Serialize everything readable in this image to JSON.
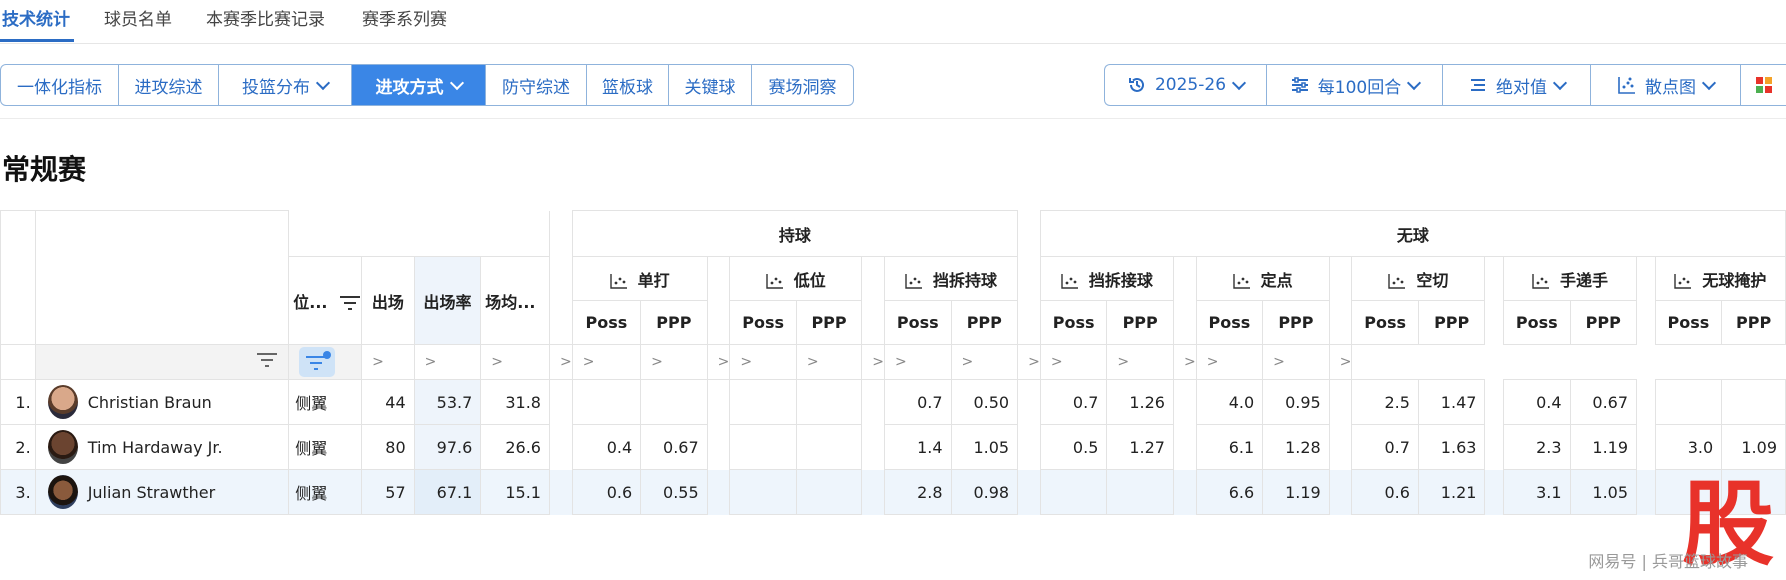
{
  "top_tabs": [
    "技术统计",
    "球员名单",
    "本赛季比赛记录",
    "赛季系列赛"
  ],
  "category_buttons": [
    "一体化指标",
    "进攻综述",
    "投篮分布",
    "进攻方式",
    "防守综述",
    "篮板球",
    "关键球",
    "赛场洞察"
  ],
  "active_category": "进攻方式",
  "controls": {
    "season": "2025-26",
    "per_mode": "每100回合",
    "value_mode": "绝对值",
    "chart_mode": "散点图"
  },
  "section_title": "常规赛",
  "table": {
    "basic_headers": {
      "position": "位...",
      "games": "出场",
      "games_pct": "出场率",
      "minutes": "场均..."
    },
    "groups": {
      "on_ball": "持球",
      "off_ball": "无球"
    },
    "play_types": [
      "单打",
      "低位",
      "挡拆持球",
      "挡拆接球",
      "定点",
      "空切",
      "手递手",
      "无球掩护"
    ],
    "sub_headers": {
      "poss": "Poss",
      "ppp": "PPP"
    },
    "filter_symbol": ">",
    "rows": [
      {
        "rank": "1.",
        "name": "Christian Braun",
        "pos": "侧翼",
        "gp": "44",
        "gp_pct": "53.7",
        "min": "31.8",
        "stats": [
          [
            "",
            ""
          ],
          [
            "",
            ""
          ],
          [
            "0.7",
            "0.50"
          ],
          [
            "0.7",
            "1.26"
          ],
          [
            "4.0",
            "0.95"
          ],
          [
            "2.5",
            "1.47"
          ],
          [
            "0.4",
            "0.67"
          ],
          [
            "",
            ""
          ]
        ]
      },
      {
        "rank": "2.",
        "name": "Tim Hardaway Jr.",
        "pos": "侧翼",
        "gp": "80",
        "gp_pct": "97.6",
        "min": "26.6",
        "stats": [
          [
            "0.4",
            "0.67"
          ],
          [
            "",
            ""
          ],
          [
            "1.4",
            "1.05"
          ],
          [
            "0.5",
            "1.27"
          ],
          [
            "6.1",
            "1.28"
          ],
          [
            "0.7",
            "1.63"
          ],
          [
            "2.3",
            "1.19"
          ],
          [
            "3.0",
            "1.09"
          ]
        ]
      },
      {
        "rank": "3.",
        "name": "Julian Strawther",
        "pos": "侧翼",
        "gp": "57",
        "gp_pct": "67.1",
        "min": "15.1",
        "stats": [
          [
            "0.6",
            "0.55"
          ],
          [
            "",
            ""
          ],
          [
            "2.8",
            "0.98"
          ],
          [
            "",
            ""
          ],
          [
            "6.6",
            "1.19"
          ],
          [
            "0.6",
            "1.21"
          ],
          [
            "3.1",
            "1.05"
          ],
          [
            "",
            ""
          ]
        ]
      }
    ]
  },
  "watermark": "网易号 | 兵哥篮球故事",
  "overlay_char": "股",
  "colors": {
    "accent": "#3a86e6",
    "link": "#2b6cc4",
    "overlay": "#e8322a",
    "row_highlight": "#eef5fc"
  }
}
